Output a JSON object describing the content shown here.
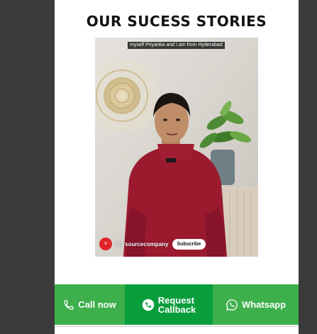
{
  "section": {
    "title": "OUR SUCESS STORIES"
  },
  "video": {
    "caption": "myself Priyanka and I am from Hyderabad",
    "channel_name": "@Vsourcecompany",
    "subscribe_label": "Subscribe"
  },
  "bottom_bar": {
    "call_label": "Call now",
    "callback_line1": "Request",
    "callback_line2": "Callback",
    "whatsapp_label": "Whatsapp"
  },
  "colors": {
    "call_green": "#3db04b",
    "callback_green": "#0a9d3c",
    "channel_red": "#e0242a"
  },
  "icons": [
    "phone-icon",
    "phone-circle-icon",
    "whatsapp-icon"
  ]
}
